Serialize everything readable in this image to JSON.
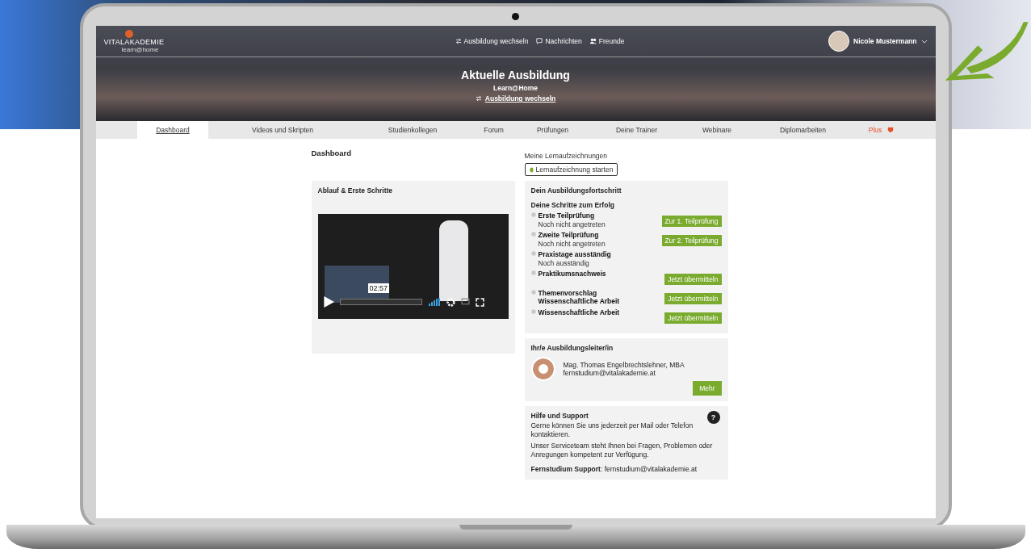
{
  "header": {
    "logo": {
      "name": "VITALAKADEMIE",
      "sub": "learn@home"
    },
    "nav": [
      {
        "kind": "switch",
        "label": "Ausbildung wechseln"
      },
      {
        "kind": "message",
        "label": "Nachrichten"
      },
      {
        "kind": "people",
        "label": "Freunde"
      }
    ],
    "user": {
      "name": "Nicole Mustermann"
    }
  },
  "hero": {
    "title": "Aktuelle Ausbildung",
    "subtitle": "Learn@Home",
    "link": "Ausbildung wechseln"
  },
  "tabs": [
    {
      "label": "Dashboard",
      "selected": true
    },
    {
      "label": "Videos und Skripten",
      "selected": false
    },
    {
      "label": "Studienkollegen",
      "selected": false
    },
    {
      "label": "Forum",
      "selected": false
    },
    {
      "label": "Prüfungen",
      "selected": false
    },
    {
      "label": "Deine Trainer",
      "selected": false
    },
    {
      "label": "Webinare",
      "selected": false
    },
    {
      "label": "Diplomarbeiten",
      "selected": false
    },
    {
      "label": "Plus",
      "selected": false,
      "kind": "plus"
    }
  ],
  "dashboard": {
    "title": "Dashboard",
    "recordings_label": "Meine Lernaufzeichnungen",
    "start_button": "Lernaufzeichnung starten"
  },
  "intro_card": {
    "title": "Ablauf & Erste Schritte",
    "video": {
      "time": "02:57"
    }
  },
  "progress_card": {
    "title": "Dein Ausbildungsfortschritt",
    "subtitle": "Deine Schritte zum Erfolg",
    "steps": [
      {
        "title": "Erste Teilprüfung",
        "status": "Noch nicht angetreten",
        "button": "Zur 1. Teilprüfung"
      },
      {
        "title": "Zweite Teilprüfung",
        "status": "Noch nicht angetreten",
        "button": "Zur 2. Teilprüfung"
      },
      {
        "title": "Praxistage ausständig",
        "status": "Noch ausständig"
      },
      {
        "title": "Praktikumsnachweis",
        "button": "Jetzt übermitteln"
      },
      {
        "title": "Themenvorschlag Wissenschaftliche Arbeit",
        "button": "Jetzt übermitteln"
      },
      {
        "title": "Wissenschaftliche Arbeit",
        "button": "Jetzt übermitteln"
      }
    ]
  },
  "leader_card": {
    "title": "Ihr/e Ausbildungsleiter/in",
    "name": "Mag. Thomas Engelbrechtslehner, MBA",
    "email": "fernstudium@vitalakademie.at",
    "button": "Mehr"
  },
  "support_card": {
    "title": "Hilfe und Support",
    "help_icon": "?",
    "paragraphs": [
      "Gerne können Sie uns jederzeit per Mail oder Telefon kontaktieren.",
      "Unser Serviceteam steht Ihnen bei Fragen, Problemen oder Anregungen kompetent zur Verfügung."
    ],
    "contact": "**Fernstudium Support**: fernstudium@vitalakademie.at"
  }
}
